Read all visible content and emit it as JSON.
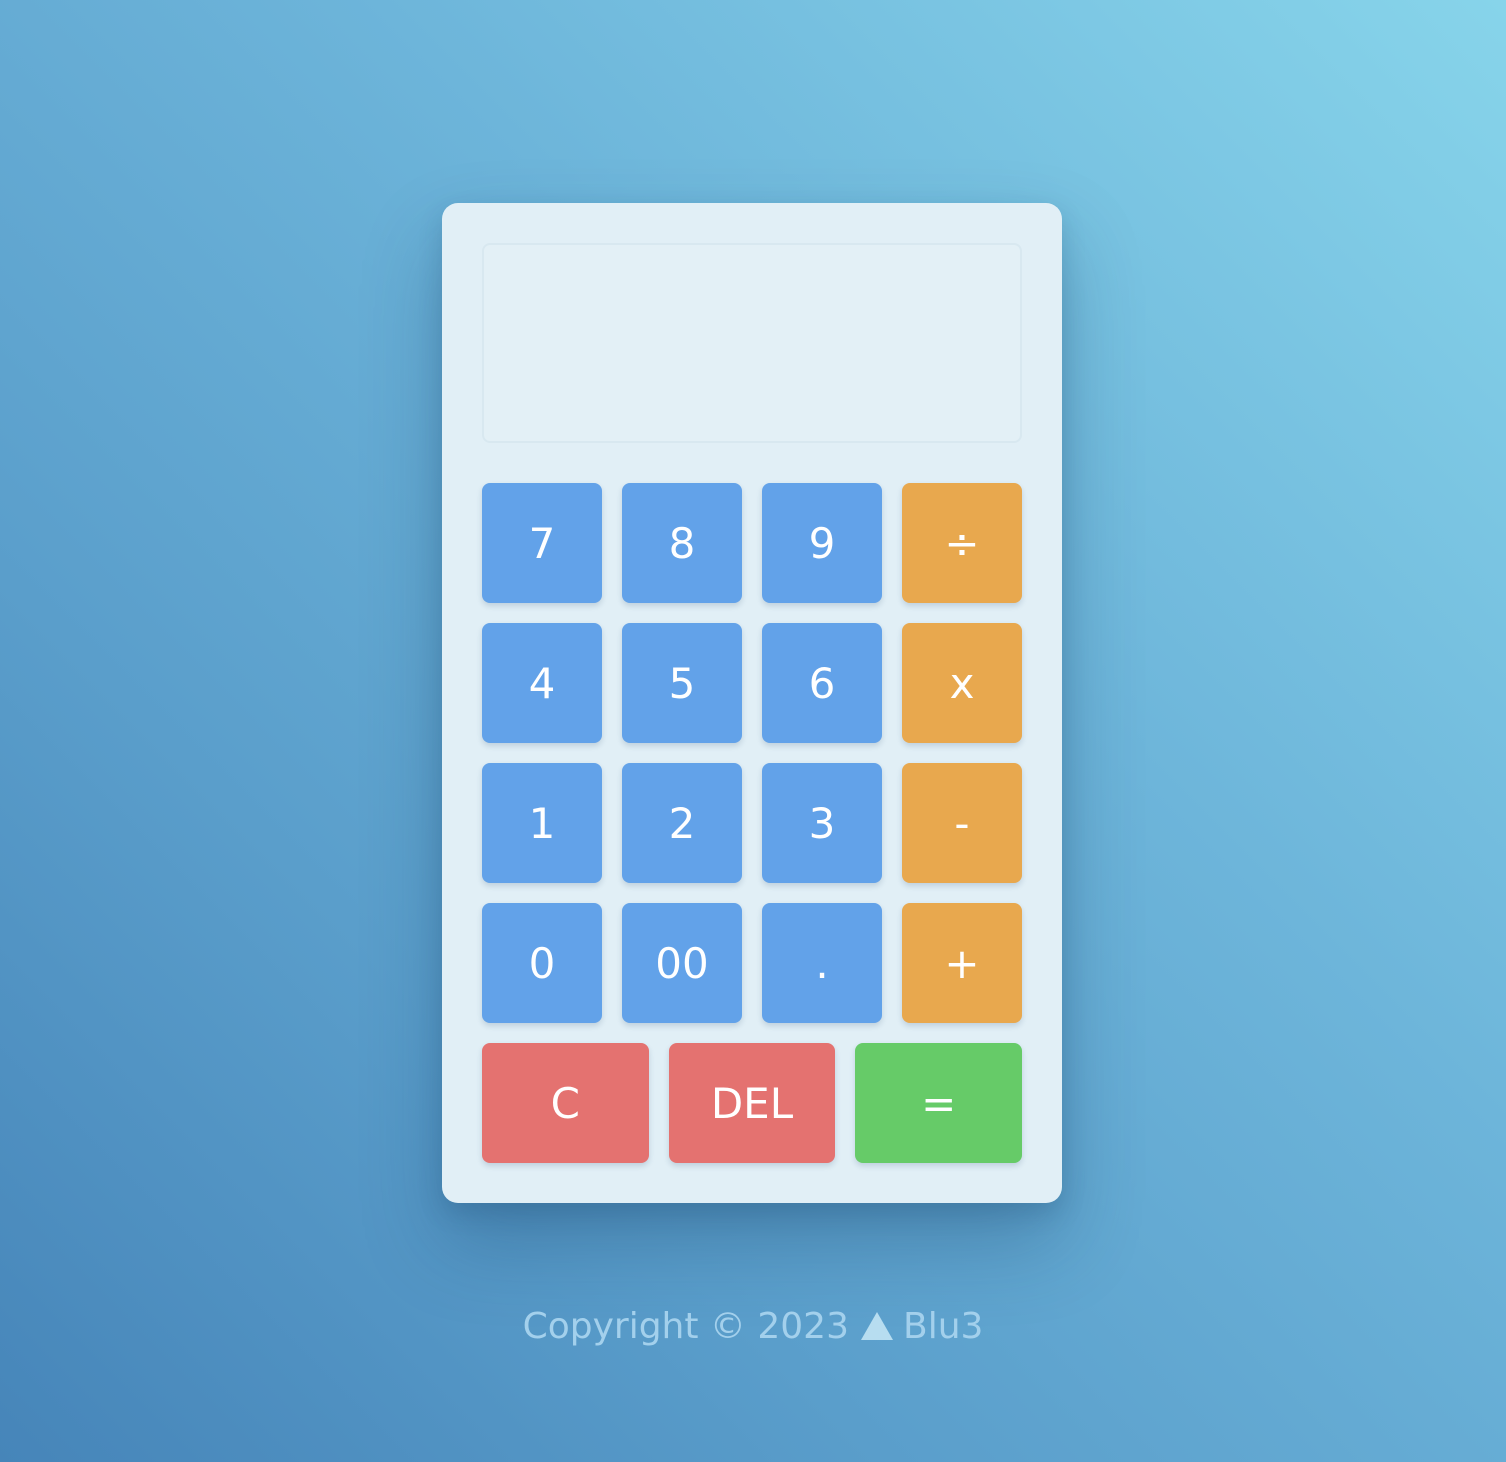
{
  "display": {
    "value": ""
  },
  "keypad": {
    "rows": [
      [
        {
          "label": "7",
          "type": "num",
          "name": "key-7-button"
        },
        {
          "label": "8",
          "type": "num",
          "name": "key-8-button"
        },
        {
          "label": "9",
          "type": "num",
          "name": "key-9-button"
        },
        {
          "label": "÷",
          "type": "op",
          "name": "divide-button"
        }
      ],
      [
        {
          "label": "4",
          "type": "num",
          "name": "key-4-button"
        },
        {
          "label": "5",
          "type": "num",
          "name": "key-5-button"
        },
        {
          "label": "6",
          "type": "num",
          "name": "key-6-button"
        },
        {
          "label": "x",
          "type": "op",
          "name": "multiply-button"
        }
      ],
      [
        {
          "label": "1",
          "type": "num",
          "name": "key-1-button"
        },
        {
          "label": "2",
          "type": "num",
          "name": "key-2-button"
        },
        {
          "label": "3",
          "type": "num",
          "name": "key-3-button"
        },
        {
          "label": "-",
          "type": "op",
          "name": "subtract-button"
        }
      ],
      [
        {
          "label": "0",
          "type": "num",
          "name": "key-0-button"
        },
        {
          "label": "00",
          "type": "num",
          "name": "key-00-button"
        },
        {
          "label": ".",
          "type": "num",
          "name": "decimal-point-button"
        },
        {
          "label": "+",
          "type": "op",
          "name": "add-button"
        }
      ]
    ],
    "bottom": [
      {
        "label": "C",
        "type": "clear",
        "name": "clear-button"
      },
      {
        "label": "DEL",
        "type": "clear",
        "name": "delete-button"
      },
      {
        "label": "=",
        "type": "equals",
        "name": "equals-button"
      }
    ]
  },
  "footer": {
    "copyright": "Copyright © 2023",
    "logo_icon": "triangle-logo-icon",
    "brand": "Blu3"
  },
  "colors": {
    "number_key": "#62a2e9",
    "operator_key": "#e8a84e",
    "clear_key": "#e47270",
    "equals_key": "#66cb68",
    "calculator_body": "#e1eff6",
    "background_top_right": "#87d4ea",
    "background_bottom_left": "#4685b9"
  }
}
